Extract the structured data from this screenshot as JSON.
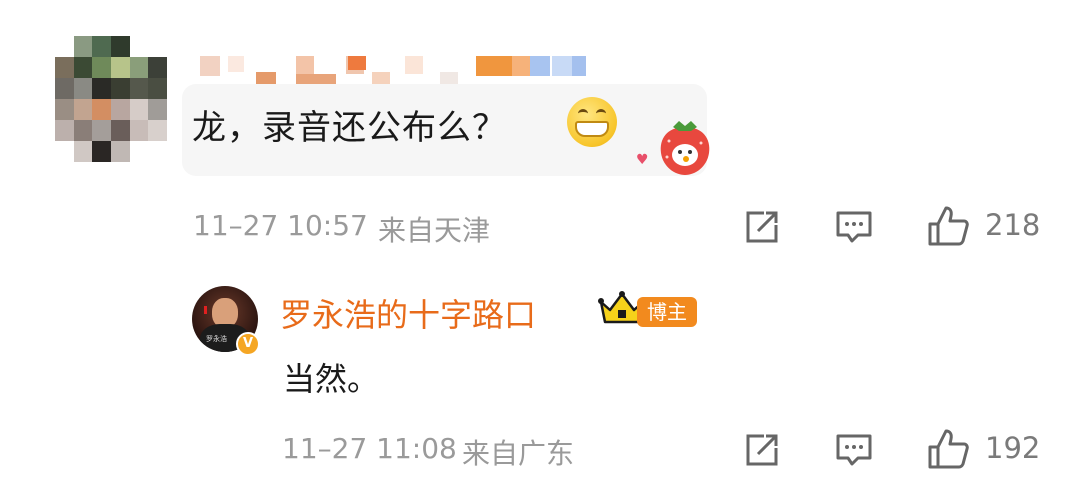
{
  "comment": {
    "text": "龙，录音还公布么？",
    "emoji": "grinning-face-emoji",
    "sticker": "strawberry-avatar-sticker",
    "time": "11–27 10:57",
    "location": "来自天津",
    "likes": "218"
  },
  "reply": {
    "author": "罗永浩的十字路口",
    "author_badge": "博主",
    "verified_mark": "V",
    "avatar_caption": "罗永浩",
    "text": "当然。",
    "time": "11–27 11:08",
    "location": "来自广东",
    "likes": "192"
  },
  "icons": {
    "share": "share-icon",
    "comment": "comment-icon",
    "like": "thumbs-up-icon",
    "crown": "crown-badge-icon",
    "heart": "heart-icon"
  },
  "colors": {
    "author_name": "#e86b1a",
    "badge": "#f28a1e",
    "meta_text": "#9a9a9a",
    "bubble": "#f6f6f6"
  }
}
